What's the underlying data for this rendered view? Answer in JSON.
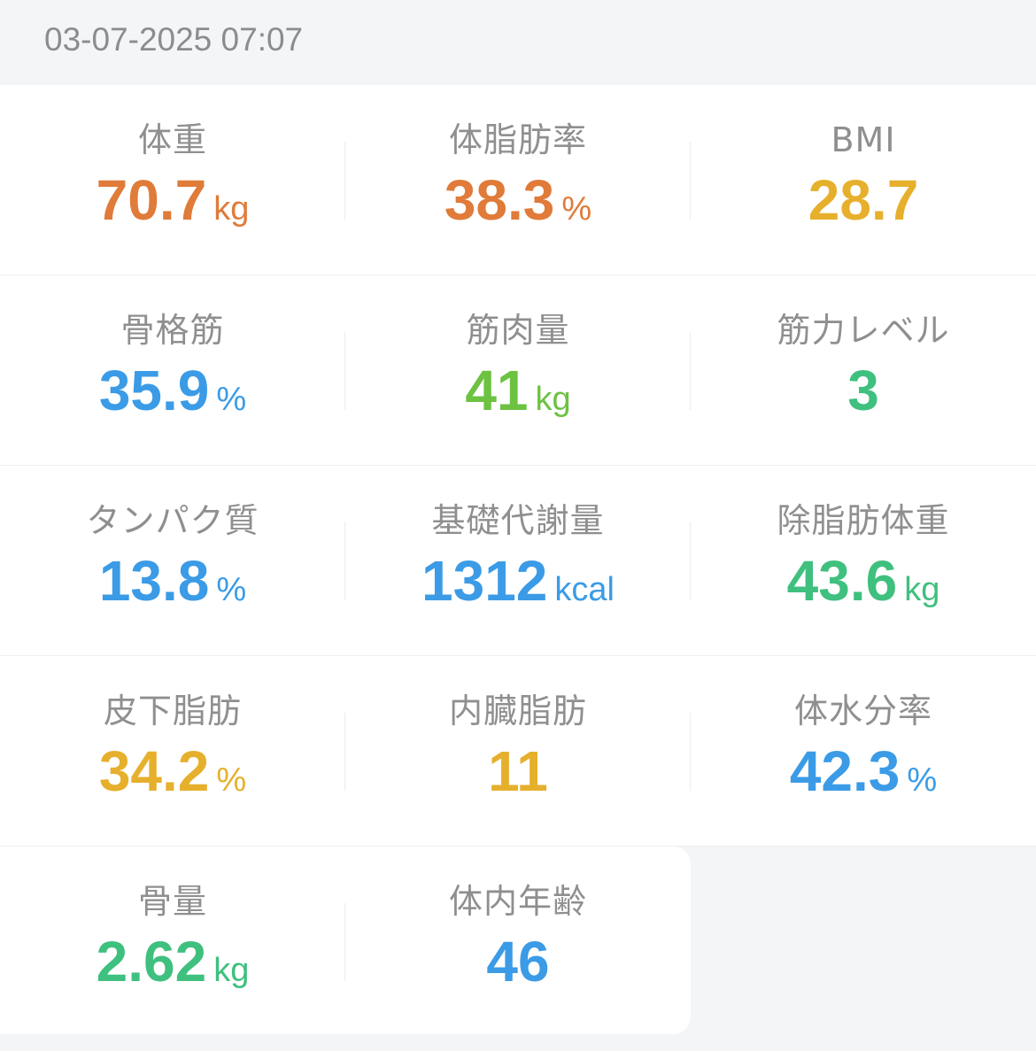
{
  "header": {
    "datetime": "03-07-2025 07:07"
  },
  "colors": {
    "orange": "#e07b39",
    "yellow": "#e6b02c",
    "blue": "#3b9be6",
    "lime": "#6dc241",
    "green": "#3fc07e"
  },
  "metrics": [
    {
      "label": "体重",
      "value": "70.7",
      "unit": "kg"
    },
    {
      "label": "体脂肪率",
      "value": "38.3",
      "unit": "%"
    },
    {
      "label": "BMI",
      "value": "28.7",
      "unit": ""
    },
    {
      "label": "骨格筋",
      "value": "35.9",
      "unit": "%"
    },
    {
      "label": "筋肉量",
      "value": "41",
      "unit": "kg"
    },
    {
      "label": "筋力レベル",
      "value": "3",
      "unit": ""
    },
    {
      "label": "タンパク質",
      "value": "13.8",
      "unit": "%"
    },
    {
      "label": "基礎代謝量",
      "value": "1312",
      "unit": "kcal"
    },
    {
      "label": "除脂肪体重",
      "value": "43.6",
      "unit": "kg"
    },
    {
      "label": "皮下脂肪",
      "value": "34.2",
      "unit": "%"
    },
    {
      "label": "内臓脂肪",
      "value": "11",
      "unit": ""
    },
    {
      "label": "体水分率",
      "value": "42.3",
      "unit": "%"
    },
    {
      "label": "骨量",
      "value": "2.62",
      "unit": "kg"
    },
    {
      "label": "体内年齢",
      "value": "46",
      "unit": ""
    }
  ]
}
